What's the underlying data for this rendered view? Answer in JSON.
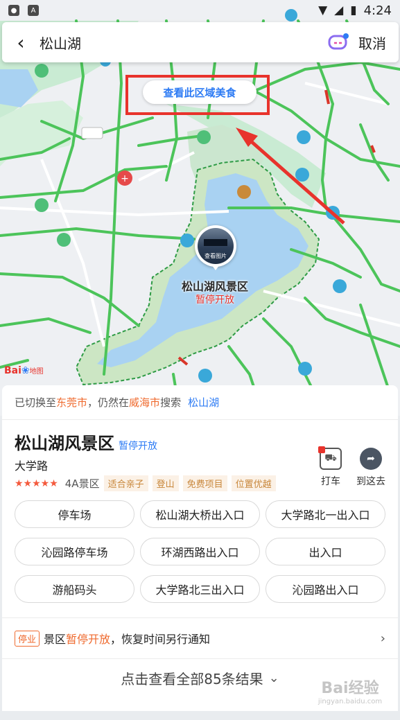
{
  "status_bar": {
    "time": "4:24"
  },
  "search": {
    "back_icon": "chevron-left-icon",
    "query": "松山湖",
    "assistant_icon": "assistant-robot-icon",
    "cancel": "取消"
  },
  "map": {
    "area_food_button": "查看此区域美食",
    "scenic_label": "松山湖风景区",
    "scenic_status": "暂停开放",
    "marker_caption": "查看图片",
    "logo": "Bai",
    "logo_sub": "地图"
  },
  "panel": {
    "switch_prefix": "已切换至",
    "switch_city": "东莞市",
    "switch_mid": "，仍然在",
    "switch_other_city": "威海市",
    "switch_suffix": "搜索",
    "switch_link": "松山湖",
    "title": "松山湖风景区",
    "title_badge": "暂停开放",
    "address": "大学路",
    "stars": "★★★★★",
    "level": "4A景区",
    "tags": [
      "适合亲子",
      "登山",
      "免费项目",
      "位置优越"
    ],
    "actions": [
      {
        "label": "打车",
        "icon": "taxi-icon"
      },
      {
        "label": "到这去",
        "icon": "route-icon"
      }
    ],
    "sub_pois": [
      "停车场",
      "松山湖大桥出入口",
      "大学路北一出入口",
      "沁园路停车场",
      "环湖西路出入口",
      "出入口",
      "游船码头",
      "大学路北三出入口",
      "沁园路出入口"
    ],
    "notice_tag": "停业",
    "notice_pre": "景区",
    "notice_red": "暂停开放",
    "notice_post": "，恢复时间另行通知",
    "more": "点击查看全部85条结果"
  },
  "watermark": {
    "text": "Bai经验",
    "sub": "jingyan.baidu.com"
  },
  "colors": {
    "accent": "#2d7bf4",
    "highlight": "#e8332c",
    "road": "#4cc45a",
    "water": "#a9d2f2"
  }
}
